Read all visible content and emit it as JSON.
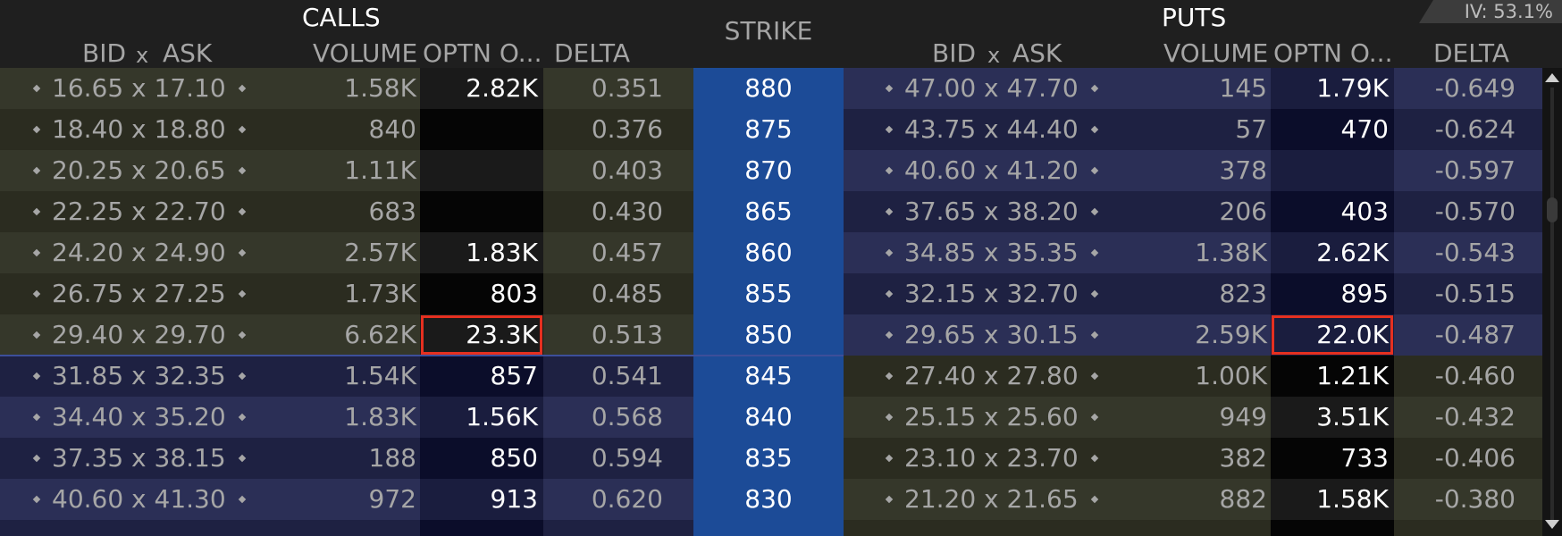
{
  "header": {
    "calls_label": "CALLS",
    "puts_label": "PUTS",
    "strike_label": "STRIKE",
    "iv_label": "IV: 53.1%",
    "calls_columns": {
      "bid": "BID",
      "x": "x",
      "ask": "ASK",
      "volume": "VOLUME",
      "open_interest": "OPTN O...",
      "delta": "DELTA"
    },
    "puts_columns": {
      "bid": "BID",
      "x": "x",
      "ask": "ASK",
      "volume": "VOLUME",
      "open_interest": "OPTN O...",
      "delta": "DELTA"
    }
  },
  "rows": [
    {
      "strike": "880",
      "call": {
        "bidask": "16.65 x 17.10",
        "volume": "1.58K",
        "oi": "2.82K",
        "delta": "0.351"
      },
      "put": {
        "bidask": "47.00 x 47.70",
        "volume": "145",
        "oi": "1.79K",
        "delta": "-0.649"
      }
    },
    {
      "strike": "875",
      "call": {
        "bidask": "18.40 x 18.80",
        "volume": "840",
        "oi": "",
        "delta": "0.376"
      },
      "put": {
        "bidask": "43.75 x 44.40",
        "volume": "57",
        "oi": "470",
        "delta": "-0.624"
      }
    },
    {
      "strike": "870",
      "call": {
        "bidask": "20.25 x 20.65",
        "volume": "1.11K",
        "oi": "",
        "delta": "0.403"
      },
      "put": {
        "bidask": "40.60 x 41.20",
        "volume": "378",
        "oi": "",
        "delta": "-0.597"
      }
    },
    {
      "strike": "865",
      "call": {
        "bidask": "22.25 x 22.70",
        "volume": "683",
        "oi": "",
        "delta": "0.430"
      },
      "put": {
        "bidask": "37.65 x 38.20",
        "volume": "206",
        "oi": "403",
        "delta": "-0.570"
      }
    },
    {
      "strike": "860",
      "call": {
        "bidask": "24.20 x 24.90",
        "volume": "2.57K",
        "oi": "1.83K",
        "delta": "0.457"
      },
      "put": {
        "bidask": "34.85 x 35.35",
        "volume": "1.38K",
        "oi": "2.62K",
        "delta": "-0.543"
      }
    },
    {
      "strike": "855",
      "call": {
        "bidask": "26.75 x 27.25",
        "volume": "1.73K",
        "oi": "803",
        "delta": "0.485"
      },
      "put": {
        "bidask": "32.15 x 32.70",
        "volume": "823",
        "oi": "895",
        "delta": "-0.515"
      }
    },
    {
      "strike": "850",
      "call": {
        "bidask": "29.40 x 29.70",
        "volume": "6.62K",
        "oi": "23.3K",
        "delta": "0.513"
      },
      "put": {
        "bidask": "29.65 x 30.15",
        "volume": "2.59K",
        "oi": "22.0K",
        "delta": "-0.487"
      }
    },
    {
      "strike": "845",
      "call": {
        "bidask": "31.85 x 32.35",
        "volume": "1.54K",
        "oi": "857",
        "delta": "0.541"
      },
      "put": {
        "bidask": "27.40 x 27.80",
        "volume": "1.00K",
        "oi": "1.21K",
        "delta": "-0.460"
      }
    },
    {
      "strike": "840",
      "call": {
        "bidask": "34.40 x 35.20",
        "volume": "1.83K",
        "oi": "1.56K",
        "delta": "0.568"
      },
      "put": {
        "bidask": "25.15 x 25.60",
        "volume": "949",
        "oi": "3.51K",
        "delta": "-0.432"
      }
    },
    {
      "strike": "835",
      "call": {
        "bidask": "37.35 x 38.15",
        "volume": "188",
        "oi": "850",
        "delta": "0.594"
      },
      "put": {
        "bidask": "23.10 x 23.70",
        "volume": "382",
        "oi": "733",
        "delta": "-0.406"
      }
    },
    {
      "strike": "830",
      "call": {
        "bidask": "40.60 x 41.30",
        "volume": "972",
        "oi": "913",
        "delta": "0.620"
      },
      "put": {
        "bidask": "21.20 x 21.65",
        "volume": "882",
        "oi": "1.58K",
        "delta": "-0.380"
      }
    }
  ],
  "highlight": {
    "color": "#e53020",
    "call_oi_strike": "850",
    "put_oi_strike": "850"
  },
  "colors": {
    "strike_bg": "#1c4b97",
    "itm_call_bg": "#2b2c20",
    "otm_bg": "#1e2142"
  }
}
